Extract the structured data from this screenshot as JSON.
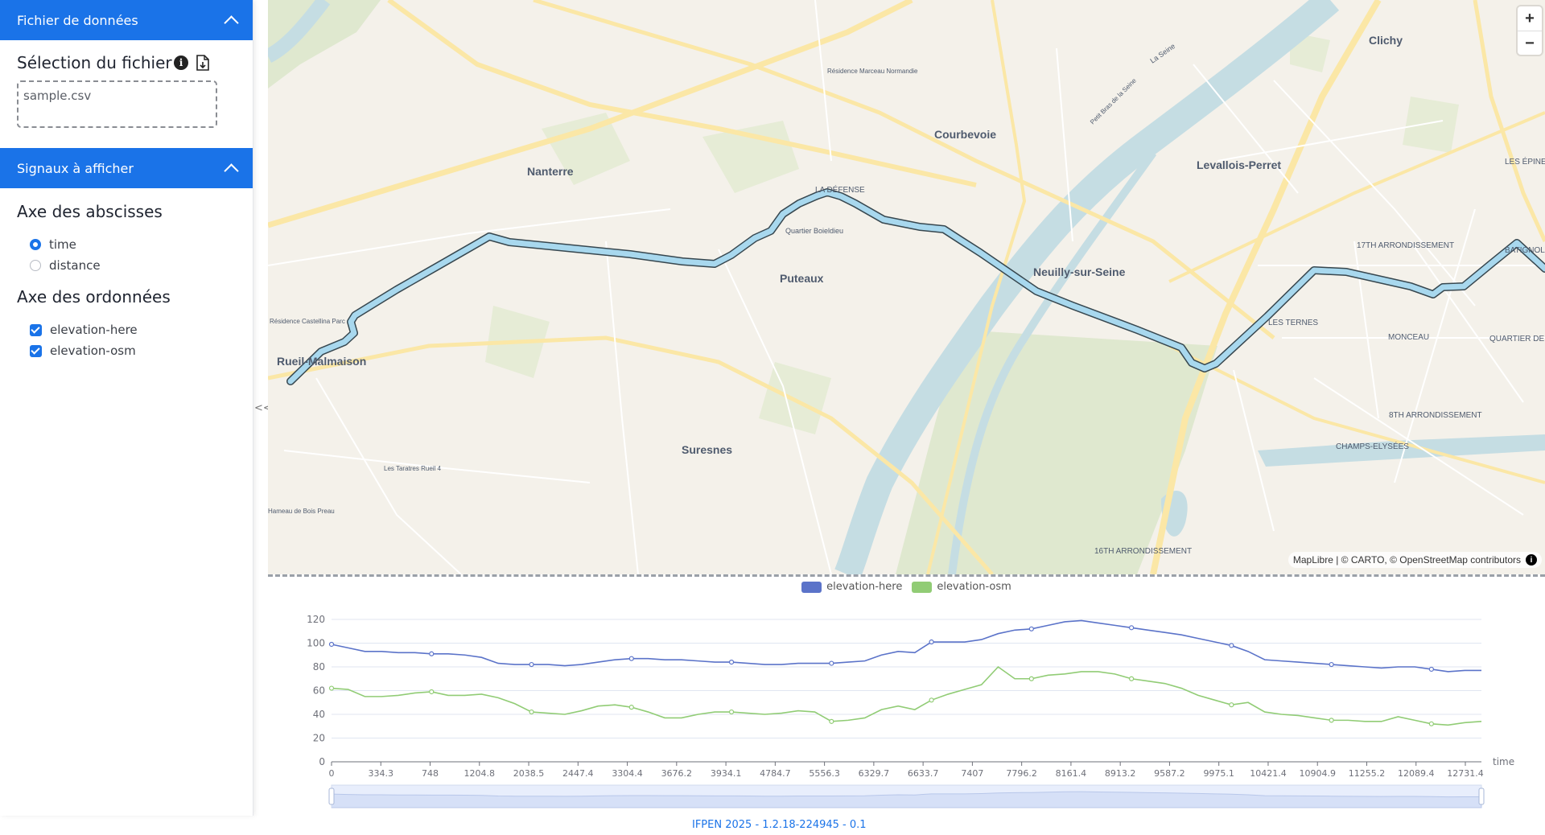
{
  "sidebar": {
    "data_file_header": "Fichier de données",
    "file_selection_title": "Sélection du fichier",
    "file_name": "sample.csv",
    "signals_header": "Signaux à afficher",
    "x_axis_title": "Axe des abscisses",
    "x_options": [
      {
        "label": "time",
        "selected": true
      },
      {
        "label": "distance",
        "selected": false
      }
    ],
    "y_axis_title": "Axe des ordonnées",
    "y_options": [
      {
        "label": "elevation-here",
        "checked": true
      },
      {
        "label": "elevation-osm",
        "checked": true
      }
    ],
    "collapse_label": "<<"
  },
  "map": {
    "labels": [
      "Clichy",
      "Nanterre",
      "Courbevoie",
      "Levallois-Perret",
      "Puteaux",
      "Neuilly-sur-Seine",
      "Rueil-Malmaison",
      "Suresnes",
      "LA DÉFENSE",
      "Quartier Boieldieu",
      "17TH ARRONDISSEMENT",
      "BATIGNOLLES",
      "LES TERNES",
      "MONCEAU",
      "8TH ARRONDISSEMENT",
      "CHAMPS-ELYSÉES",
      "16TH ARRONDISSEMENT",
      "QUARTIER DE L'EUROPE",
      "LES ÉPINETTES",
      "Résidence Marceau Normandie",
      "Résidence Castellina Parc",
      "Les Taratres Rueil 4",
      "Hameau de Bois Preau",
      "La Seine",
      "Petit Bras de la Seine"
    ],
    "zoom_in": "+",
    "zoom_out": "−",
    "attribution": "MapLibre | © CARTO, © OpenStreetMap contributors",
    "route_color": "#a8d8ee",
    "water_color": "#c5dde3",
    "park_color": "#dfe8cf",
    "road_color": "#fbe7a6"
  },
  "chart_data": {
    "type": "line",
    "legend": [
      "elevation-here",
      "elevation-osm"
    ],
    "xlabel": "time",
    "x_tick_labels": [
      "0",
      "334.3",
      "748",
      "1204.8",
      "2038.5",
      "2447.4",
      "3304.4",
      "3676.2",
      "3934.1",
      "4784.7",
      "5556.3",
      "6329.7",
      "6633.7",
      "7407",
      "7796.2",
      "8161.4",
      "8913.2",
      "9587.2",
      "9975.1",
      "10421.4",
      "10904.9",
      "11255.2",
      "12089.4",
      "12731.4"
    ],
    "ylim": [
      0,
      120
    ],
    "y_ticks": [
      0,
      20,
      40,
      60,
      80,
      100,
      120
    ],
    "series": [
      {
        "name": "elevation-here",
        "color": "#5b73c9",
        "values": [
          99,
          96,
          93,
          93,
          92,
          92,
          91,
          91,
          90,
          88,
          83,
          82,
          82,
          82,
          81,
          82,
          84,
          86,
          87,
          87,
          86,
          86,
          85,
          84,
          84,
          83,
          82,
          82,
          83,
          83,
          83,
          84,
          85,
          90,
          93,
          92,
          101,
          101,
          101,
          103,
          108,
          111,
          112,
          115,
          118,
          119,
          117,
          115,
          113,
          111,
          109,
          107,
          104,
          101,
          98,
          93,
          86,
          85,
          84,
          83,
          82,
          81,
          80,
          79,
          80,
          80,
          78,
          76,
          77,
          77
        ]
      },
      {
        "name": "elevation-osm",
        "color": "#91cc75",
        "values": [
          62,
          61,
          55,
          55,
          56,
          58,
          59,
          56,
          56,
          57,
          54,
          49,
          42,
          41,
          40,
          43,
          47,
          48,
          46,
          42,
          37,
          37,
          40,
          42,
          42,
          41,
          40,
          41,
          43,
          42,
          34,
          35,
          37,
          44,
          47,
          44,
          52,
          57,
          61,
          65,
          80,
          70,
          70,
          73,
          74,
          76,
          76,
          74,
          70,
          68,
          66,
          62,
          56,
          52,
          48,
          50,
          42,
          40,
          39,
          37,
          35,
          35,
          34,
          34,
          38,
          35,
          32,
          31,
          33,
          34
        ]
      }
    ],
    "grid": true
  },
  "footer": {
    "version": "IFPEN 2025 - 1.2.18-224945  - 0.1"
  }
}
